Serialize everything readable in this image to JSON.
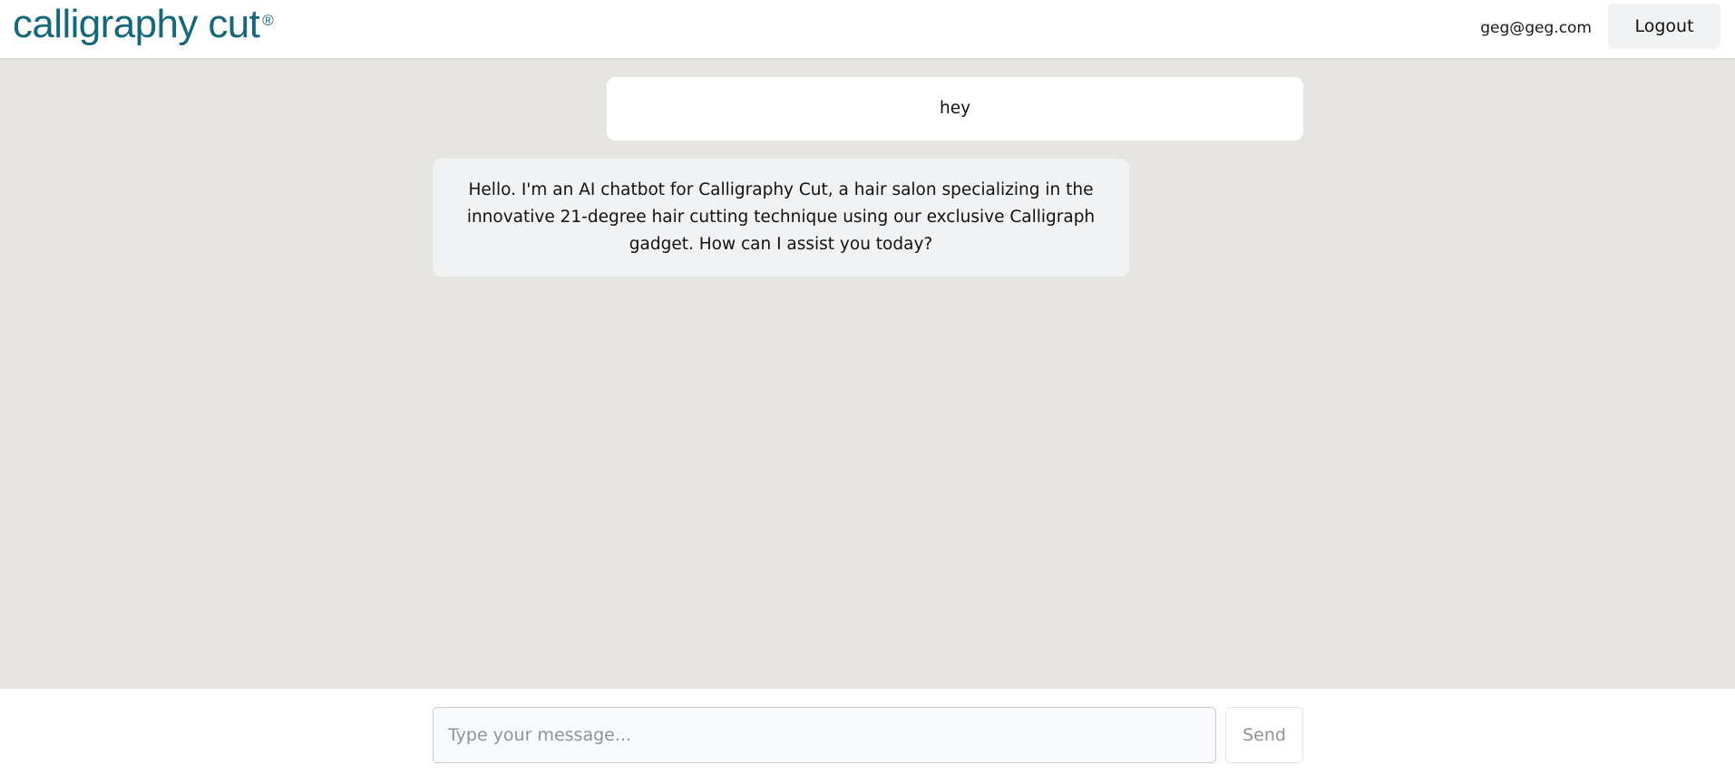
{
  "header": {
    "logo_text": "calligraphy cut",
    "logo_mark": "®",
    "user_email": "geg@geg.com",
    "logout_label": "Logout"
  },
  "messages": [
    {
      "role": "user",
      "text": "hey"
    },
    {
      "role": "assistant",
      "text": "Hello. I'm an AI chatbot for Calligraphy Cut, a hair salon specializing in the innovative 21-degree hair cutting technique using our exclusive Calligraph gadget. How can I assist you today?"
    }
  ],
  "composer": {
    "placeholder": "Type your message...",
    "value": "",
    "send_label": "Send"
  },
  "colors": {
    "brand": "#16677b",
    "chat_background": "#e6e5e1",
    "user_bubble": "#ffffff",
    "assistant_bubble": "#f1f2f4"
  }
}
